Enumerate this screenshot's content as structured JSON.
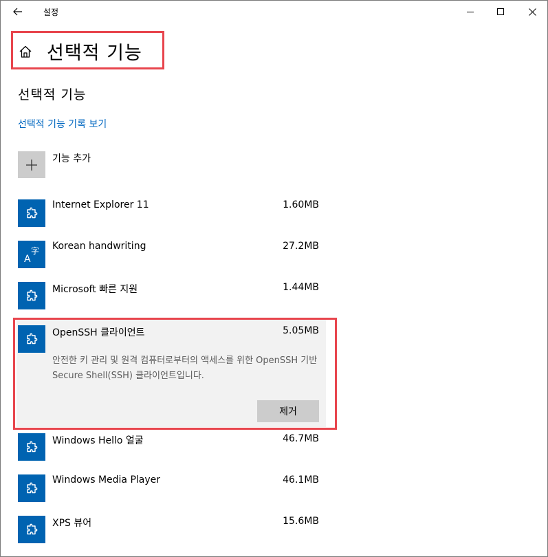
{
  "window": {
    "title": "설정"
  },
  "header": {
    "title": "선택적 기능"
  },
  "section": {
    "title": "선택적 기능",
    "history_link": "선택적 기능 기록 보기"
  },
  "add": {
    "label": "기능 추가"
  },
  "features": [
    {
      "name": "Internet Explorer 11",
      "size": "1.60MB",
      "icon": "puzzle-icon"
    },
    {
      "name": "Korean handwriting",
      "size": "27.2MB",
      "icon": "language-icon"
    },
    {
      "name": "Microsoft 빠른 지원",
      "size": "1.44MB",
      "icon": "puzzle-icon"
    },
    {
      "name": "OpenSSH 클라이언트",
      "size": "5.05MB",
      "icon": "puzzle-icon",
      "description": "안전한 키 관리 및 원격 컴퓨터로부터의 액세스를 위한 OpenSSH 기반 Secure Shell(SSH) 클라이언트입니다.",
      "remove_label": "제거"
    },
    {
      "name": "Windows Hello 얼굴",
      "size": "46.7MB",
      "icon": "puzzle-icon"
    },
    {
      "name": "Windows Media Player",
      "size": "46.1MB",
      "icon": "puzzle-icon"
    },
    {
      "name": "XPS 뷰어",
      "size": "15.6MB",
      "icon": "puzzle-icon"
    }
  ],
  "colors": {
    "accent": "#0063b1",
    "link": "#0067c0",
    "highlight": "#e8454d",
    "tile_gray": "#cccccc",
    "expanded_bg": "#f2f2f2"
  }
}
